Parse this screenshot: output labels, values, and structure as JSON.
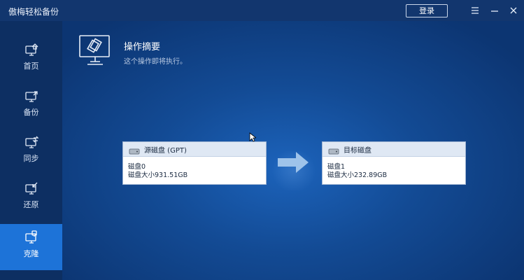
{
  "app": {
    "title": "傲梅轻松备份",
    "login_label": "登录"
  },
  "titlebar_icons": [
    "menu-icon",
    "minimize-icon",
    "close-icon"
  ],
  "sidebar": {
    "items": [
      {
        "label": "首页",
        "icon": "home-icon",
        "active": false
      },
      {
        "label": "备份",
        "icon": "backup-icon",
        "active": false
      },
      {
        "label": "同步",
        "icon": "sync-icon",
        "active": false
      },
      {
        "label": "还原",
        "icon": "restore-icon",
        "active": false
      },
      {
        "label": "克隆",
        "icon": "clone-icon",
        "active": true
      }
    ]
  },
  "main": {
    "title": "操作摘要",
    "subtitle": "这个操作即将执行。",
    "source": {
      "title": "源磁盘 (GPT)",
      "line1": "磁盘0",
      "line2": "磁盘大小931.51GB"
    },
    "target": {
      "title": "目标磁盘",
      "line1": "磁盘1",
      "line2": "磁盘大小232.89GB"
    }
  },
  "colors": {
    "accent": "#1d73d8",
    "sidebar": "#0d2f62",
    "titlebar": "#12366e",
    "card_header": "#dfe8f4"
  }
}
